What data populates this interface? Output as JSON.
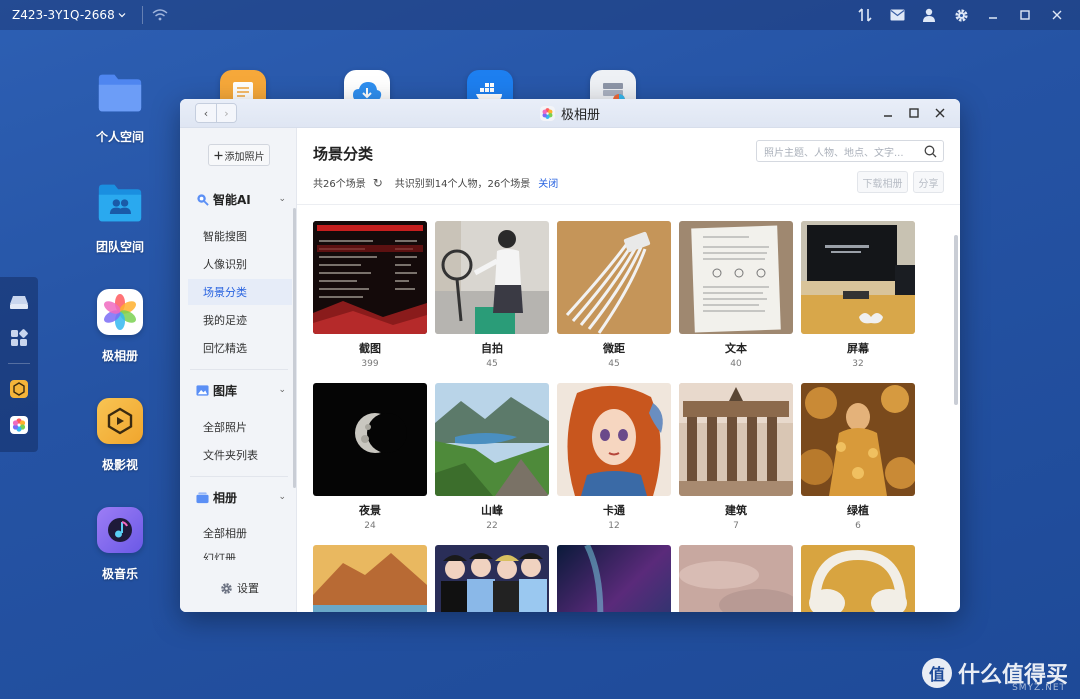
{
  "topbar": {
    "device_name": "Z423-3Y1Q-2668",
    "icons": [
      "chevron-down-icon",
      "wifi-icon",
      "transfer-icon",
      "message-icon",
      "user-icon",
      "gear-icon",
      "minimize-icon",
      "maximize-icon",
      "close-icon"
    ]
  },
  "desktop": {
    "icons": [
      {
        "label": "个人空间",
        "icon": "folder-icon",
        "color": "#5b8ff5"
      },
      {
        "label": "团队空间",
        "icon": "team-folder-icon",
        "color": "#27a3e8"
      },
      {
        "label": "极相册",
        "icon": "photos-icon",
        "color": "#ffffff"
      },
      {
        "label": "极影视",
        "icon": "video-icon",
        "color": "#f5b43a"
      },
      {
        "label": "极音乐",
        "icon": "music-icon",
        "color": "#8a6df0"
      }
    ],
    "top_row_icons": [
      "notes-icon",
      "cloud-download-icon",
      "docker-icon",
      "database-icon"
    ]
  },
  "window": {
    "title": "极相册",
    "nav": {
      "back": "‹",
      "forward": "›"
    },
    "sidebar": {
      "add_photo": "添加照片",
      "sections": [
        {
          "title": "智能AI",
          "icon": "ai-search-icon",
          "items": [
            "智能搜图",
            "人像识别",
            "场景分类",
            "我的足迹",
            "回忆精选"
          ]
        },
        {
          "title": "图库",
          "icon": "gallery-icon",
          "items": [
            "全部照片",
            "文件夹列表"
          ]
        },
        {
          "title": "相册",
          "icon": "album-icon",
          "items": [
            "全部相册",
            "幻灯册"
          ]
        }
      ],
      "active_item": "场景分类",
      "settings": "设置"
    },
    "main": {
      "title": "场景分类",
      "search_placeholder": "照片主题、人物、地点、文字...",
      "scene_count": "共26个场景",
      "recognized": "共识别到14个人物，26个场景",
      "close_link": "关闭",
      "download_button": "下载相册",
      "share_button": "分享",
      "scenes": [
        {
          "name": "截图",
          "count": "399"
        },
        {
          "name": "自拍",
          "count": "45"
        },
        {
          "name": "微距",
          "count": "45"
        },
        {
          "name": "文本",
          "count": "40"
        },
        {
          "name": "屏幕",
          "count": "32"
        },
        {
          "name": "夜景",
          "count": "24"
        },
        {
          "name": "山峰",
          "count": "22"
        },
        {
          "name": "卡通",
          "count": "12"
        },
        {
          "name": "建筑",
          "count": "7"
        },
        {
          "name": "绿植",
          "count": "6"
        },
        {
          "name": "",
          "count": ""
        },
        {
          "name": "",
          "count": ""
        },
        {
          "name": "",
          "count": ""
        },
        {
          "name": "",
          "count": ""
        },
        {
          "name": "",
          "count": ""
        }
      ]
    }
  },
  "watermark": {
    "text": "什么值得买",
    "site": "SMYZ.NET"
  }
}
